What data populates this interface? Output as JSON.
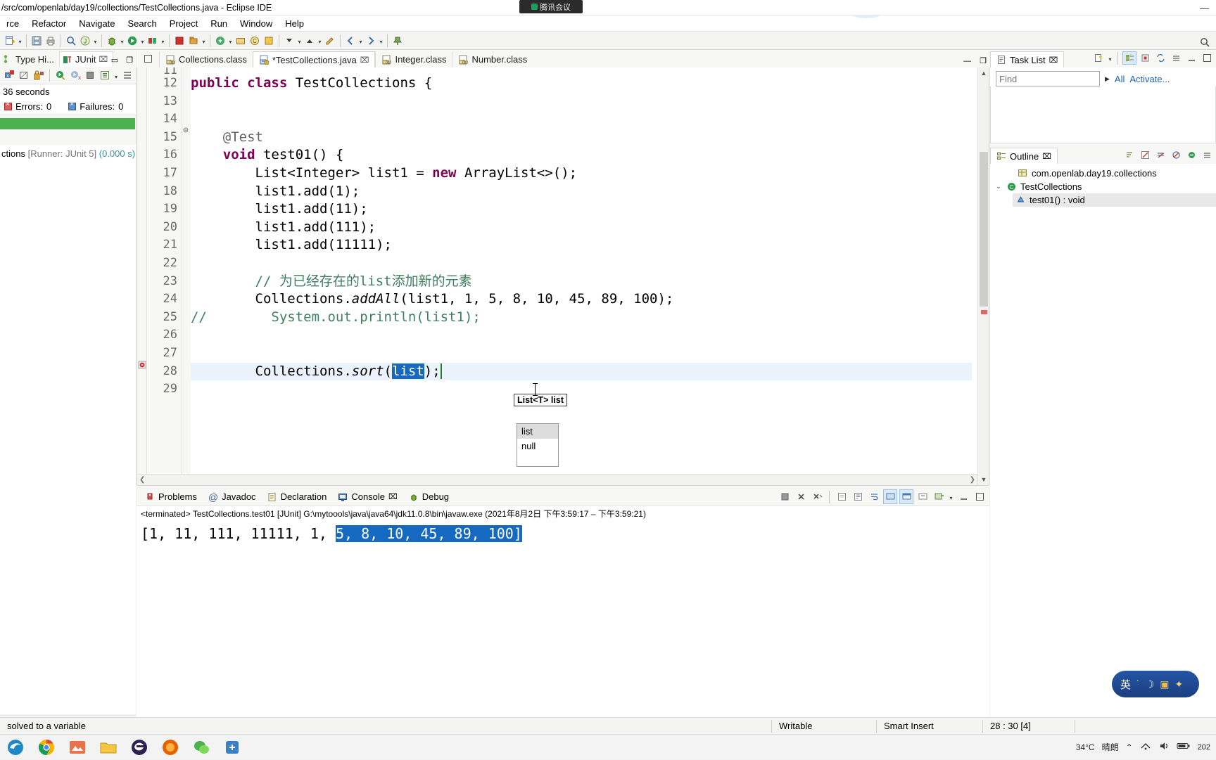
{
  "window": {
    "title": "/src/com/openlab/day19/collections/TestCollections.java - Eclipse IDE",
    "minimize": "—",
    "maximize": "❐",
    "close": "✕"
  },
  "meeting_widget": {
    "label": "腾讯会议"
  },
  "menubar": {
    "items": [
      {
        "label": "rce"
      },
      {
        "label": "Refactor"
      },
      {
        "label": "Navigate"
      },
      {
        "label": "Search"
      },
      {
        "label": "Project"
      },
      {
        "label": "Run"
      },
      {
        "label": "Window"
      },
      {
        "label": "Help"
      }
    ]
  },
  "toolbar": {
    "search_icon": "search-icon",
    "buttons": [
      "new-icon",
      "save-icon",
      "print-icon",
      "debug-icon",
      "run-icon",
      "run-last-icon",
      "coverage-icon",
      "external-tools-icon",
      "new-java-project-icon",
      "new-class-icon",
      "search-file-icon",
      "next-annotation-icon",
      "previous-annotation-icon",
      "last-edit-icon",
      "back-icon",
      "forward-icon",
      "pin-icon"
    ]
  },
  "left_view": {
    "tabs": [
      {
        "label": "Type Hi...",
        "icon": "type-hierarchy-icon",
        "active": false
      },
      {
        "label": "JUnit",
        "icon": "junit-icon",
        "active": true,
        "close": "⌧"
      }
    ],
    "toolbar_icons": [
      "next-failure-icon",
      "previous-failure-icon",
      "show-failures-only-icon",
      "rerun-test-icon",
      "rerun-failed-icon",
      "stop-icon",
      "test-run-history-icon",
      "view-menu-icon"
    ],
    "elapsed": "36 seconds",
    "errors_label": "Errors:",
    "errors_value": "0",
    "failures_label": "Failures:",
    "failures_value": "0",
    "bar_color": "#4caf50",
    "tree": [
      {
        "name": "ctions",
        "runner": "[Runner: JUnit 5]",
        "duration": "(0.000 s)"
      }
    ],
    "bottom_icons": [
      "collapse-all-icon",
      "filter-icon",
      "view-menu-icon"
    ]
  },
  "editor": {
    "tabs": [
      {
        "label": "Collections.class",
        "icon": "class-file-icon",
        "active": false
      },
      {
        "label": "*TestCollections.java",
        "icon": "java-file-icon",
        "active": true,
        "close": "⌧"
      },
      {
        "label": "Integer.class",
        "icon": "class-file-icon",
        "active": false
      },
      {
        "label": "Number.class",
        "icon": "class-file-icon",
        "active": false
      }
    ],
    "minimize": "—",
    "maximize": "❐",
    "first_partial_line": "11",
    "lines": [
      {
        "num": "12",
        "tokens": [
          {
            "t": "public",
            "c": "kw"
          },
          {
            "t": " ",
            "c": ""
          },
          {
            "t": "class",
            "c": "kw"
          },
          {
            "t": " TestCollections {",
            "c": ""
          }
        ]
      },
      {
        "num": "13",
        "tokens": [
          {
            "t": "",
            "c": ""
          }
        ]
      },
      {
        "num": "14",
        "tokens": [
          {
            "t": "",
            "c": ""
          }
        ]
      },
      {
        "num": "15",
        "fold": true,
        "tokens": [
          {
            "t": "    ",
            "c": ""
          },
          {
            "t": "@Test",
            "c": "ann"
          }
        ]
      },
      {
        "num": "16",
        "tokens": [
          {
            "t": "    ",
            "c": ""
          },
          {
            "t": "void",
            "c": "kw"
          },
          {
            "t": " test01() {",
            "c": ""
          }
        ]
      },
      {
        "num": "17",
        "tokens": [
          {
            "t": "        List<Integer> list1 = ",
            "c": ""
          },
          {
            "t": "new",
            "c": "kw"
          },
          {
            "t": " ArrayList<>();",
            "c": ""
          }
        ]
      },
      {
        "num": "18",
        "tokens": [
          {
            "t": "        list1.add(1);",
            "c": ""
          }
        ]
      },
      {
        "num": "19",
        "tokens": [
          {
            "t": "        list1.add(11);",
            "c": ""
          }
        ]
      },
      {
        "num": "20",
        "tokens": [
          {
            "t": "        list1.add(111);",
            "c": ""
          }
        ]
      },
      {
        "num": "21",
        "tokens": [
          {
            "t": "        list1.add(11111);",
            "c": ""
          }
        ]
      },
      {
        "num": "22",
        "tokens": [
          {
            "t": "",
            "c": ""
          }
        ]
      },
      {
        "num": "23",
        "tokens": [
          {
            "t": "        ",
            "c": ""
          },
          {
            "t": "// 为已经存在的list添加新的元素",
            "c": "cmt"
          }
        ]
      },
      {
        "num": "24",
        "tokens": [
          {
            "t": "        Collections.",
            "c": ""
          },
          {
            "t": "addAll",
            "c": "ital"
          },
          {
            "t": "(list1, 1, 5, 8, 10, 45, 89, 100);",
            "c": ""
          }
        ]
      },
      {
        "num": "25",
        "comment_marker": "//",
        "tokens": [
          {
            "t": "        System.out.println(list1);",
            "c": "cmt"
          }
        ]
      },
      {
        "num": "26",
        "tokens": [
          {
            "t": "",
            "c": ""
          }
        ]
      },
      {
        "num": "27",
        "tokens": [
          {
            "t": "",
            "c": ""
          }
        ]
      },
      {
        "num": "28",
        "current": true,
        "marker": "error-marker-icon",
        "tokens": [
          {
            "t": "        Collections.",
            "c": ""
          },
          {
            "t": "sort",
            "c": "ital"
          },
          {
            "t": "(",
            "c": ""
          },
          {
            "t": "list",
            "c": "sel"
          },
          {
            "t": ");",
            "c": ""
          }
        ]
      },
      {
        "num": "29",
        "tokens": [
          {
            "t": "",
            "c": ""
          }
        ]
      }
    ],
    "content_assist": {
      "tooltip": "List<T> list",
      "proposals": [
        {
          "label": "list",
          "selected": true
        },
        {
          "label": "null",
          "selected": false
        }
      ]
    }
  },
  "console_panel": {
    "tabs": [
      {
        "label": "Problems",
        "icon": "problems-icon",
        "active": false
      },
      {
        "label": "Javadoc",
        "icon": "javadoc-icon",
        "active": false
      },
      {
        "label": "Declaration",
        "icon": "declaration-icon",
        "active": false
      },
      {
        "label": "Console",
        "icon": "console-icon",
        "active": true,
        "close": "⌧"
      },
      {
        "label": "Debug",
        "icon": "debug-icon",
        "active": false
      }
    ],
    "toolbar_icons": [
      "terminate-icon",
      "remove-launch-icon",
      "remove-all-terminated-icon",
      "clear-console-icon",
      "scroll-lock-icon",
      "word-wrap-icon",
      "show-console-on-output-icon",
      "pin-console-icon",
      "display-selected-console-icon",
      "open-console-icon",
      "minimize-icon",
      "maximize-icon"
    ],
    "terminated_line": "<terminated> TestCollections.test01 [JUnit] G:\\mytoools\\java\\java64\\jdk11.0.8\\bin\\javaw.exe  (2021年8月2日 下午3:59:17 – 下午3:59:21)",
    "output_prefix": "[1, 11, 111, 11111, 1, ",
    "output_selected": "5, 8, 10, 45, 89, 100]"
  },
  "task_list": {
    "tab_label": "Task List",
    "tab_close": "⌧",
    "find_placeholder": "Find",
    "all_label": "All",
    "activate_label": "Activate...",
    "toolbar_icons": [
      "new-task-icon",
      "menu-arrow-icon",
      "categorize-icon",
      "focus-icon",
      "synchronize-icon",
      "view-menu-icon",
      "minimize-icon",
      "maximize-icon"
    ]
  },
  "outline": {
    "tab_label": "Outline",
    "tab_close": "⌧",
    "toolbar_icons": [
      "sort-icon",
      "hide-fields-icon",
      "hide-static-icon",
      "hide-nonpublic-icon",
      "collapse-all-icon",
      "view-menu-icon"
    ],
    "items": [
      {
        "label": "com.openlab.day19.collections",
        "icon": "package-icon",
        "indent": 1,
        "chevron": "",
        "selected": false
      },
      {
        "label": "TestCollections",
        "icon": "class-icon",
        "indent": 0,
        "chevron": "⌄",
        "selected": false
      },
      {
        "label": "test01() : void",
        "icon": "method-icon",
        "indent": 2,
        "chevron": "",
        "selected": true
      }
    ]
  },
  "status_bar": {
    "left_message": "solved to a variable",
    "writable": "Writable",
    "insert_mode": "Smart Insert",
    "position": "28 : 30 [4]"
  },
  "taskbar": {
    "apps": [
      "edge-icon",
      "chrome-icon",
      "app-orange-icon",
      "file-explorer-icon",
      "eclipse-icon",
      "firefox-icon",
      "wechat-icon",
      "tool-icon"
    ],
    "weather_temp": "34°C",
    "weather_desc": "晴朗",
    "tray_icons": [
      "chevron-up-icon",
      "network-icon",
      "volume-icon",
      "battery-icon"
    ],
    "clock_time": "",
    "clock_date": "202"
  },
  "ime": {
    "mode": "英",
    "icons": [
      "ime-dot-icon",
      "ime-moon-icon",
      "ime-box-icon",
      "ime-star-icon"
    ]
  }
}
